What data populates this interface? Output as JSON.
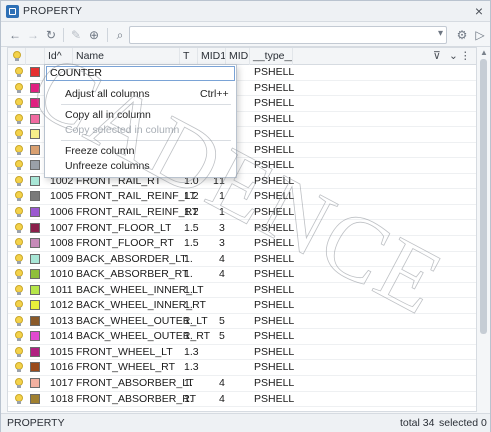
{
  "window": {
    "title": "PROPERTY",
    "close": "×"
  },
  "toolbar": {
    "back": "←",
    "forward": "→",
    "refresh": "↻",
    "pin": "✎",
    "zoom": "⊕",
    "search": "⌕",
    "search_value": "",
    "settings": "⚙",
    "play": "▷"
  },
  "columns": [
    "",
    "",
    "Id",
    "Name",
    "T",
    "MID1",
    "MID",
    "__type__"
  ],
  "sort_marker": "^",
  "rows": [
    {
      "id": "",
      "name": "",
      "t": "",
      "mid1": "",
      "mid": "",
      "type": "PSHELL",
      "color": "#e53030"
    },
    {
      "id": "",
      "name": "",
      "t": "",
      "mid1": "",
      "mid": "",
      "type": "PSHELL",
      "color": "#e02080"
    },
    {
      "id": "",
      "name": "",
      "t": "",
      "mid1": "",
      "mid": "",
      "type": "PSHELL",
      "color": "#e02080"
    },
    {
      "id": "",
      "name": "",
      "t": "",
      "mid1": "",
      "mid": "",
      "type": "PSHELL",
      "color": "#f06aa0"
    },
    {
      "id": "",
      "name": "",
      "t": "",
      "mid1": "",
      "mid": "",
      "type": "PSHELL",
      "color": "#f7ef8a"
    },
    {
      "id": "",
      "name": "",
      "t": "",
      "mid1": "",
      "mid": "",
      "type": "PSHELL",
      "color": "#d9a070"
    },
    {
      "id": "",
      "name": "",
      "t": "",
      "mid1": "",
      "mid": "",
      "type": "PSHELL",
      "color": "#9aa0a8"
    },
    {
      "id": "1002",
      "name": "FRONT_RAIL_RT",
      "t": "1.0",
      "mid1": "1",
      "mid": "1",
      "type": "PSHELL",
      "color": "#a8e6d6"
    },
    {
      "id": "1005",
      "name": "FRONT_RAIL_REINF_LT",
      "t": "1.2",
      "mid1": "",
      "mid": "1",
      "type": "PSHELL",
      "color": "#7a7a7a"
    },
    {
      "id": "1006",
      "name": "FRONT_RAIL_REINF_RT",
      "t": "1.2",
      "mid1": "",
      "mid": "1",
      "type": "PSHELL",
      "color": "#9b59d0"
    },
    {
      "id": "1007",
      "name": "FRONT_FLOOR_LT",
      "t": "1.5",
      "mid1": "",
      "mid": "3",
      "type": "PSHELL",
      "color": "#8a1f4a"
    },
    {
      "id": "1008",
      "name": "FRONT_FLOOR_RT",
      "t": "1.5",
      "mid1": "",
      "mid": "3",
      "type": "PSHELL",
      "color": "#c68ab8"
    },
    {
      "id": "1009",
      "name": "BACK_ABSORDER_LT",
      "t": "1.",
      "mid1": "",
      "mid": "4",
      "type": "PSHELL",
      "color": "#a8e6d6"
    },
    {
      "id": "1010",
      "name": "BACK_ABSORBER_RT",
      "t": "1.",
      "mid1": "",
      "mid": "4",
      "type": "PSHELL",
      "color": "#8fbf3a"
    },
    {
      "id": "1011",
      "name": "BACK_WHEEL_INNER_LT",
      "t": "1.",
      "mid1": "",
      "mid": "",
      "type": "PSHELL",
      "color": "#b6e64a"
    },
    {
      "id": "1012",
      "name": "BACK_WHEEL_INNER_RT",
      "t": "1.",
      "mid1": "",
      "mid": "",
      "type": "PSHELL",
      "color": "#e9ef3a"
    },
    {
      "id": "1013",
      "name": "BACK_WHEEL_OUTER_LT",
      "t": "1.",
      "mid1": "",
      "mid": "5",
      "type": "PSHELL",
      "color": "#8a5a2a"
    },
    {
      "id": "1014",
      "name": "BACK_WHEEL_OUTER_RT",
      "t": "1.",
      "mid1": "",
      "mid": "5",
      "type": "PSHELL",
      "color": "#e04ad0"
    },
    {
      "id": "1015",
      "name": "FRONT_WHEEL_LT",
      "t": "1.3",
      "mid1": "",
      "mid": "",
      "type": "PSHELL",
      "color": "#b02080"
    },
    {
      "id": "1016",
      "name": "FRONT_WHEEL_RT",
      "t": "1.3",
      "mid1": "",
      "mid": "",
      "type": "PSHELL",
      "color": "#9a4a1a"
    },
    {
      "id": "1017",
      "name": "FRONT_ABSORBER_LT",
      "t": "1.",
      "mid1": "",
      "mid": "4",
      "type": "PSHELL",
      "color": "#f2b0a0"
    },
    {
      "id": "1018",
      "name": "FRONT_ABSORBER_RT",
      "t": "1.",
      "mid1": "",
      "mid": "4",
      "type": "PSHELL",
      "color": "#a08030"
    }
  ],
  "popup": {
    "input_value": "COUNTER",
    "items": [
      {
        "label": "Adjust all columns",
        "shortcut": "Ctrl++",
        "disabled": false
      },
      {
        "label": "Copy all in column",
        "shortcut": "",
        "disabled": false
      },
      {
        "label": "Copy selected in column",
        "shortcut": "",
        "disabled": true
      },
      {
        "label": "Freeze column",
        "shortcut": "",
        "disabled": false
      },
      {
        "label": "Unfreeze columns",
        "shortcut": "",
        "disabled": false
      }
    ]
  },
  "status": {
    "left": "PROPERTY",
    "total": "total 34",
    "selected": "selected 0"
  },
  "watermark": "CADENCE"
}
